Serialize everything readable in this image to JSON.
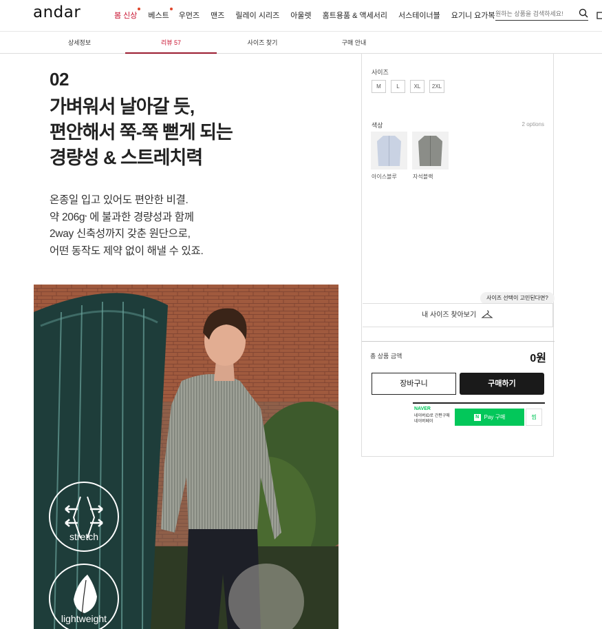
{
  "header": {
    "logo": "andar",
    "nav": [
      {
        "label": "봄 신상",
        "highlight": true,
        "dot": true
      },
      {
        "label": "베스트",
        "highlight": false,
        "dot": true
      },
      {
        "label": "우먼즈",
        "highlight": false,
        "dot": false
      },
      {
        "label": "맨즈",
        "highlight": false,
        "dot": false
      },
      {
        "label": "릴레이 시리즈",
        "highlight": false,
        "dot": false
      },
      {
        "label": "아울렛",
        "highlight": false,
        "dot": false
      },
      {
        "label": "홈트용품 & 액세서리",
        "highlight": false,
        "dot": false
      },
      {
        "label": "서스테이너블",
        "highlight": false,
        "dot": false
      },
      {
        "label": "요기니 요가복",
        "highlight": false,
        "dot": false
      }
    ],
    "search_placeholder": "원하는 상품을 검색하세요!"
  },
  "tabs": [
    {
      "label": "상세정보",
      "active": false
    },
    {
      "label": "리뷰 57",
      "active": true
    },
    {
      "label": "사이즈 찾기",
      "active": false
    },
    {
      "label": "구매 안내",
      "active": false
    }
  ],
  "feature": {
    "number": "02",
    "headline": [
      "가벼워서 날아갈 듯,",
      "편안해서 쭉-쭉 뻗게 되는",
      "경량성 & 스트레치력"
    ],
    "body": {
      "line1": "온종일 입고 있어도 편안한 비결.",
      "line2_pre": "약 206g",
      "line2_sup": "*",
      "line2_post": " 에 불과한 경량성과 함께",
      "line3": "2way 신축성까지 갖춘 원단으로,",
      "line4": "어떤 동작도 제약 없이 해낼 수 있죠."
    },
    "badges": [
      "stretch",
      "lightweight"
    ]
  },
  "panel": {
    "size_label": "사이즈",
    "sizes": [
      "M",
      "L",
      "XL",
      "2XL"
    ],
    "color_label": "색상",
    "color_count": "2 options",
    "colors": [
      {
        "name": "아이스블루",
        "hex": "#c9d2e3"
      },
      {
        "name": "자석블랙",
        "hex": "#8b8d88"
      }
    ],
    "size_tip": "사이즈 선택이 고민된다면?",
    "my_size": "내 사이즈 찾아보기",
    "total_label": "총 상품 금액",
    "total_value": "0원",
    "cart": "장바구니",
    "buy": "구매하기",
    "naver_brand": "NAVER",
    "naver_sub1": "네이버ID로 간편구매",
    "naver_sub2": "네이버페이",
    "npay": "Pay 구매",
    "npay_n": "N",
    "npay_wish": "찜"
  },
  "colors": {
    "accent": "#c8102e",
    "naver": "#03c75a",
    "dark": "#1a1a1a"
  }
}
